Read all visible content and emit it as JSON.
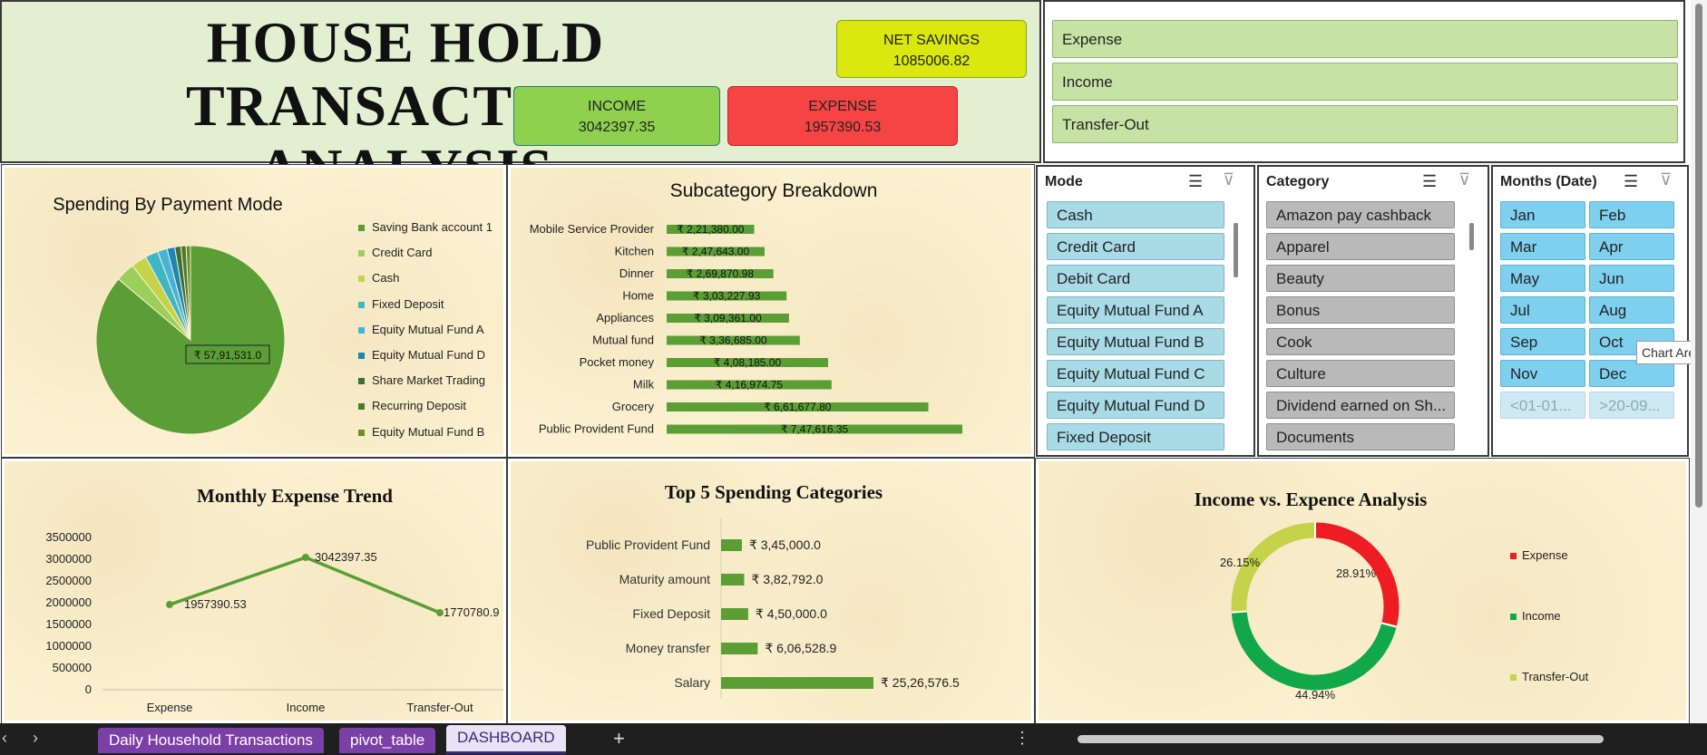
{
  "header": {
    "title_line1": "HOUSE HOLD TRANSACTION",
    "title_line2": "ANALYSIS",
    "net_savings_label": "NET SAVINGS",
    "net_savings_value": "1085006.82",
    "income_label": "INCOME",
    "income_value": "3042397.35",
    "expense_label": "EXPENSE",
    "expense_value": "1957390.53"
  },
  "type_slicer": {
    "items": [
      "Expense",
      "Income",
      "Transfer-Out"
    ]
  },
  "mode_slicer": {
    "title": "Mode",
    "items": [
      "Cash",
      "Credit Card",
      "Debit Card",
      "Equity Mutual Fund A",
      "Equity Mutual Fund B",
      "Equity Mutual Fund C",
      "Equity Mutual Fund D",
      "Fixed Deposit"
    ]
  },
  "category_slicer": {
    "title": "Category",
    "items": [
      "Amazon pay cashback",
      "Apparel",
      "Beauty",
      "Bonus",
      "Cook",
      "Culture",
      "Dividend earned on Sh...",
      "Documents"
    ]
  },
  "months_slicer": {
    "title": "Months (Date)",
    "items": [
      "Jan",
      "Feb",
      "Mar",
      "Apr",
      "May",
      "Jun",
      "Jul",
      "Aug",
      "Sep",
      "Oct",
      "Nov",
      "Dec",
      "<01-01...",
      ">20-09..."
    ],
    "tooltip": "Chart Area"
  },
  "pie_chart": {
    "title": "Spending By Payment Mode",
    "data_label": "₹ 57,91,531.0",
    "legend": [
      {
        "name": "Saving Bank account 1",
        "color": "#5a9e35"
      },
      {
        "name": "Credit Card",
        "color": "#9bcf5a"
      },
      {
        "name": "Cash",
        "color": "#c4d34a"
      },
      {
        "name": "Fixed Deposit",
        "color": "#3fb6c8"
      },
      {
        "name": "Equity Mutual Fund A",
        "color": "#46b4d8"
      },
      {
        "name": "Equity Mutual Fund D",
        "color": "#1c86b4"
      },
      {
        "name": "Share Market Trading",
        "color": "#3b6f3b"
      },
      {
        "name": "Recurring Deposit",
        "color": "#4a7a2e"
      },
      {
        "name": "Equity Mutual Fund B",
        "color": "#6f8f2f"
      }
    ]
  },
  "subcategory_chart": {
    "title": "Subcategory Breakdown",
    "bar_color": "#5a9e35"
  },
  "monthly_trend": {
    "title": "Monthly Expense Trend",
    "line_color": "#5a9e35"
  },
  "top5_chart": {
    "title": "Top 5 Spending Categories",
    "bar_color": "#5a9e35"
  },
  "income_expense_chart": {
    "title": "Income vs. Expence Analysis",
    "legend": [
      {
        "name": "Expense",
        "color": "#ee1d23"
      },
      {
        "name": "Income",
        "color": "#11a84a"
      },
      {
        "name": "Transfer-Out",
        "color": "#c4d34a"
      }
    ]
  },
  "chart_data": [
    {
      "type": "pie",
      "title": "Spending By Payment Mode",
      "categories": [
        "Saving Bank account 1",
        "Credit Card",
        "Cash",
        "Fixed Deposit",
        "Equity Mutual Fund A",
        "Equity Mutual Fund D",
        "Share Market Trading",
        "Recurring Deposit",
        "Equity Mutual Fund B"
      ],
      "values": [
        5791531.0,
        220000,
        180000,
        150000,
        110000,
        90000,
        70000,
        60000,
        50000
      ]
    },
    {
      "type": "bar",
      "title": "Subcategory Breakdown",
      "categories": [
        "Mobile Service Provider",
        "Kitchen",
        "Dinner",
        "Home",
        "Appliances",
        "Mutual fund",
        "Pocket money",
        "Milk",
        "Grocery",
        "Public Provident Fund"
      ],
      "values": [
        221380.0,
        247643.0,
        269870.98,
        303227.93,
        309361.0,
        336685.0,
        408185.0,
        416974.75,
        661677.8,
        747616.35
      ],
      "labels": [
        "₹ 2,21,380.00",
        "₹ 2,47,643.00",
        "₹ 2,69,870.98",
        "₹ 3,03,227.93",
        "₹ 3,09,361.00",
        "₹ 3,36,685.00",
        "₹ 4,08,185.00",
        "₹ 4,16,974.75",
        "₹ 6,61,677.80",
        "₹ 7,47,616.35"
      ]
    },
    {
      "type": "line",
      "title": "Monthly Expense Trend",
      "categories": [
        "Expense",
        "Income",
        "Transfer-Out"
      ],
      "values": [
        1957390.53,
        3042397.35,
        1770780.9
      ],
      "labels": [
        "1957390.53",
        "3042397.35",
        "1770780.9"
      ],
      "y_ticks": [
        "3500000",
        "3000000",
        "2500000",
        "2000000",
        "1500000",
        "1000000",
        "500000",
        "0"
      ],
      "ylim": [
        0,
        3500000
      ]
    },
    {
      "type": "bar",
      "title": "Top 5 Spending Categories",
      "categories": [
        "Public Provident Fund",
        "Maturity amount",
        "Fixed Deposit",
        "Money transfer",
        "Salary"
      ],
      "values": [
        345000.0,
        382792.0,
        450000.0,
        606528.9,
        2526576.5
      ],
      "labels": [
        "₹ 3,45,000.0",
        "₹ 3,82,792.0",
        "₹ 4,50,000.0",
        "₹ 6,06,528.9",
        "₹ 25,26,576.5"
      ]
    },
    {
      "type": "pie",
      "title": "Income vs. Expence Analysis",
      "categories": [
        "Expense",
        "Income",
        "Transfer-Out"
      ],
      "values": [
        28.91,
        44.94,
        26.15
      ],
      "labels": [
        "28.91%",
        "44.94%",
        "26.15%"
      ]
    }
  ],
  "sheet_tabs": {
    "tabs": [
      "Daily Household Transactions",
      "pivot_table",
      "DASHBOARD"
    ],
    "add": "+"
  }
}
